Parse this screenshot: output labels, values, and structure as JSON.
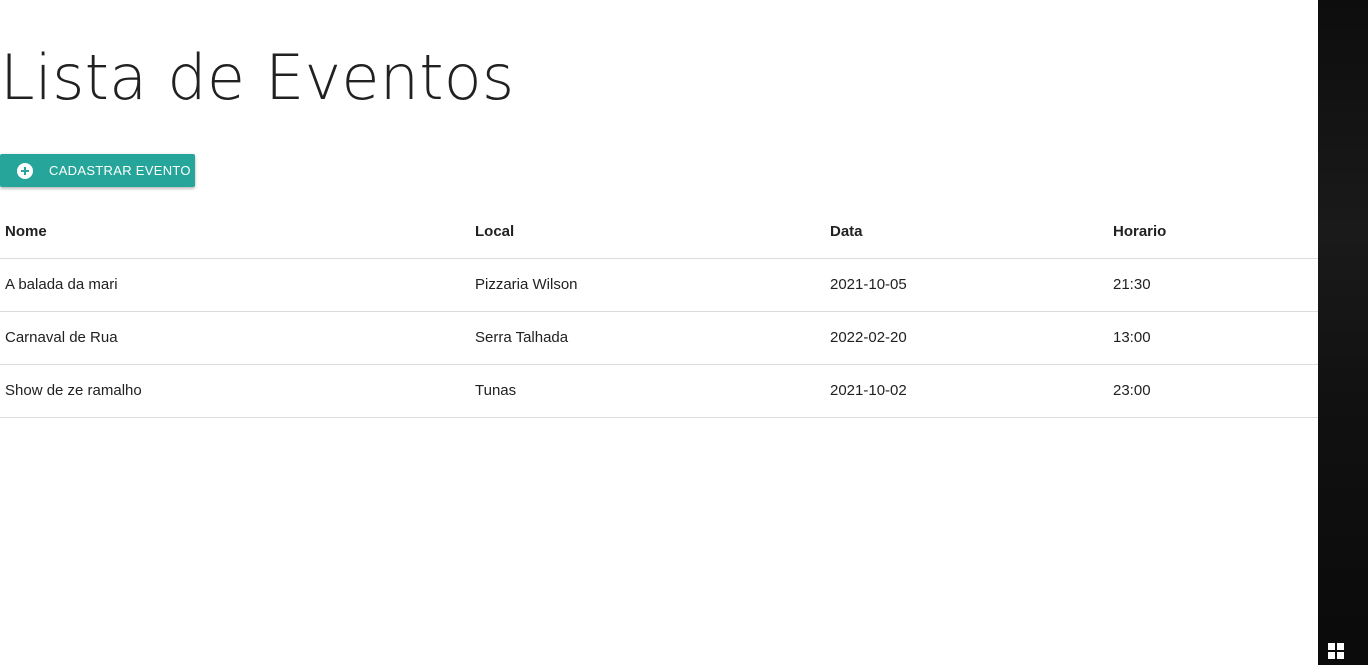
{
  "page": {
    "title": "Lista de Eventos"
  },
  "actions": {
    "add_event_label": "CADASTRAR EVENTO",
    "add_event_icon": "plus-circle-icon"
  },
  "table": {
    "headers": [
      "Nome",
      "Local",
      "Data",
      "Horario"
    ],
    "rows": [
      [
        "A balada da mari",
        "Pizzaria Wilson",
        "2021-10-05",
        "21:30"
      ],
      [
        "Carnaval de Rua",
        "Serra Talhada",
        "2022-02-20",
        "13:00"
      ],
      [
        "Show de ze ramalho",
        "Tunas",
        "2021-10-02",
        "23:00"
      ]
    ]
  },
  "taskbar": {
    "start_icon": "windows-icon"
  },
  "colors": {
    "accent": "#26a69a",
    "text": "#212121",
    "divider": "#dcdcdc"
  }
}
